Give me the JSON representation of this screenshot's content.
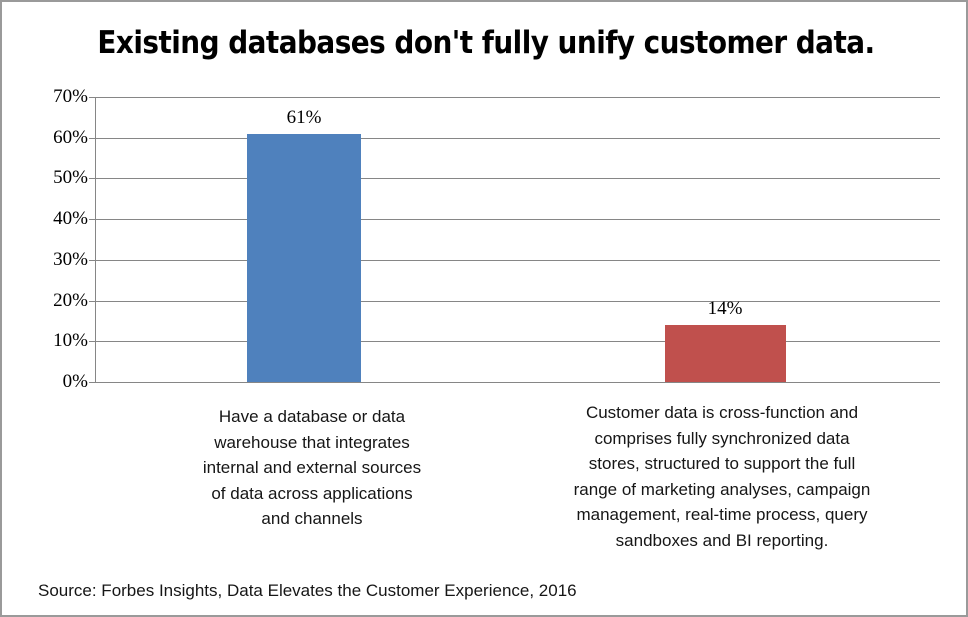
{
  "chart_data": {
    "type": "bar",
    "title": "Existing databases don't fully unify customer data.",
    "categories": [
      "Have a database or data warehouse that integrates internal and external sources of data across applications and channels",
      "Customer data is cross-function and comprises fully synchronized data stores, structured to support the full range of marketing analyses, campaign management, real-time process, query sandboxes and BI reporting."
    ],
    "category_lines": [
      [
        "Have a database or data",
        "warehouse that integrates",
        "internal and external sources",
        "of data across applications",
        "and channels"
      ],
      [
        "Customer data is cross-function and",
        "comprises fully synchronized data",
        "stores, structured to support the full",
        "range of marketing analyses, campaign",
        "management, real-time process, query",
        "sandboxes and BI reporting."
      ]
    ],
    "values": [
      61,
      14
    ],
    "value_labels": [
      "61%",
      "14%"
    ],
    "bar_colors": [
      "#4f81bd",
      "#c0504d"
    ],
    "xlabel": "",
    "ylabel": "",
    "ylim": [
      0,
      70
    ],
    "ytick_values": [
      0,
      10,
      20,
      30,
      40,
      50,
      60,
      70
    ],
    "ytick_labels": [
      "0%",
      "10%",
      "20%",
      "30%",
      "40%",
      "50%",
      "60%",
      "70%"
    ],
    "grid": true,
    "grid_color": "#868686",
    "legend": false,
    "legend_position": "none",
    "source_note": "Source: Forbes Insights, Data Elevates the Customer Experience, 2016",
    "background_color": "#ffffff",
    "border_color": "#9a9a9a"
  }
}
